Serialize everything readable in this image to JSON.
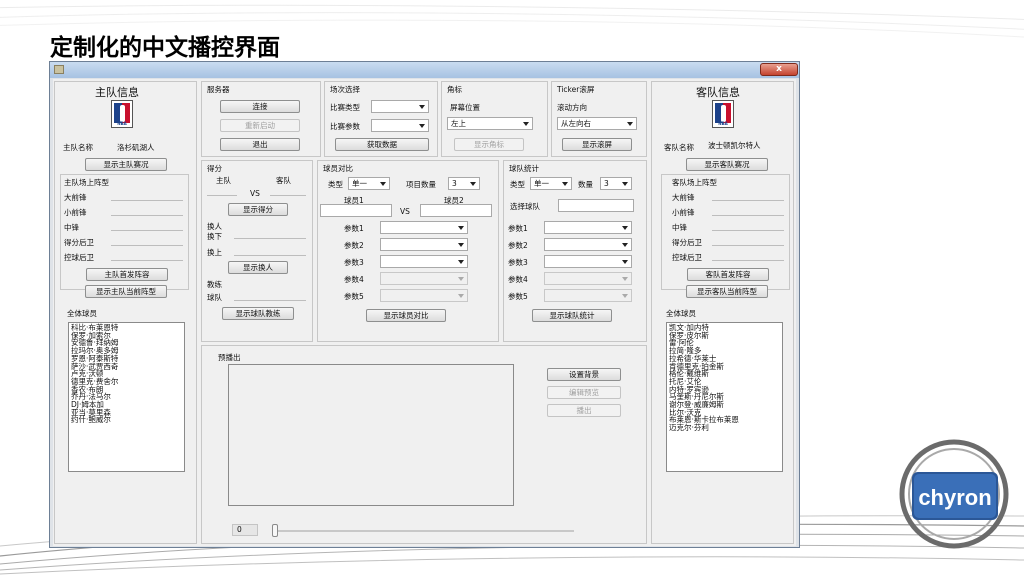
{
  "slide": {
    "title": "定制化的中文播控界面",
    "logo_text": "chyron"
  },
  "window": {
    "close_label": "x"
  },
  "home": {
    "header": "主队信息",
    "logo_text": "NBA",
    "name_label": "主队名称",
    "name_value": "洛杉矶湖人",
    "show_status_button": "显示主队赛况",
    "lineup_group": "主队场上阵型",
    "positions": [
      "大前锋",
      "小前锋",
      "中锋",
      "得分后卫",
      "控球后卫"
    ],
    "starting_button": "主队首发阵容",
    "current_formation_button": "显示主队当前阵型",
    "roster_label": "全体球员",
    "roster": [
      "科比·布莱恩特",
      "保罗·加索尔",
      "安德鲁·拜纳姆",
      "拉玛尔·奥多姆",
      "罗恩·阿泰斯特",
      "萨沙·武贾西奇",
      "卢克·沃顿",
      "德里克·费舍尔",
      "香农·布朗",
      "乔丹·法马尔",
      "DJ·姆本加",
      "亚当·莫里森",
      "约什·鲍威尔"
    ]
  },
  "away": {
    "header": "客队信息",
    "logo_text": "NBA",
    "name_label": "客队名称",
    "name_value": "波士顿凯尔特人",
    "show_status_button": "显示客队赛况",
    "lineup_group": "客队场上阵型",
    "positions": [
      "大前锋",
      "小前锋",
      "中锋",
      "得分后卫",
      "控球后卫"
    ],
    "starting_button": "客队首发阵容",
    "current_formation_button": "显示客队当前阵型",
    "roster_label": "全体球员",
    "roster": [
      "凯文·加内特",
      "保罗·皮尔斯",
      "雷·阿伦",
      "拉简·隆多",
      "拉希德·华莱士",
      "肯德里克·珀金斯",
      "格伦·戴维斯",
      "托尼·艾伦",
      "内特·罗宾逊",
      "马奎斯·丹尼尔斯",
      "谢尔登·威廉姆斯",
      "比尔·沃克",
      "布莱恩·斯卡拉布莱恩",
      "迈克尔·芬利"
    ]
  },
  "server": {
    "label": "服务器",
    "connect": "连接",
    "reconnect": "重新启动",
    "exit": "退出"
  },
  "match": {
    "label": "场次选择",
    "type_label": "比赛类型",
    "param_label": "比赛参数",
    "fetch_button": "获取数据"
  },
  "corner": {
    "label": "角标",
    "position_label": "屏幕位置",
    "position_value": "左上",
    "show_button": "显示角标"
  },
  "ticker": {
    "label": "Ticker滚屏",
    "direction_label": "滚动方向",
    "direction_value": "从左向右",
    "show_button": "显示滚屏"
  },
  "score": {
    "label": "得分",
    "home": "主队",
    "away": "客队",
    "vs": "VS",
    "show_button": "显示得分",
    "sub_in": "换人",
    "sub_out": "换下",
    "sub_on": "换上",
    "show_sub_button": "显示换人",
    "coach_label": "教练",
    "team_label": "球队",
    "show_coach_button": "显示球队教练"
  },
  "compare": {
    "label": "球员对比",
    "type_label": "类型",
    "type_value": "单一",
    "count_label": "项目数量",
    "count_value": "3",
    "player1": "球员1",
    "player2": "球员2",
    "vs": "VS",
    "params": [
      "参数1",
      "参数2",
      "参数3",
      "参数4",
      "参数5"
    ],
    "button": "显示球员对比"
  },
  "stats": {
    "label": "球队统计",
    "type_label": "类型",
    "type_value": "单一",
    "count_label": "数量",
    "count_value": "3",
    "select_team_label": "选择球队",
    "params": [
      "参数1",
      "参数2",
      "参数3",
      "参数4",
      "参数5"
    ],
    "button": "显示球队统计"
  },
  "preview": {
    "label": "预播出",
    "set_bg": "设置背景",
    "edit": "编辑预览",
    "output": "播出",
    "position": "0"
  }
}
